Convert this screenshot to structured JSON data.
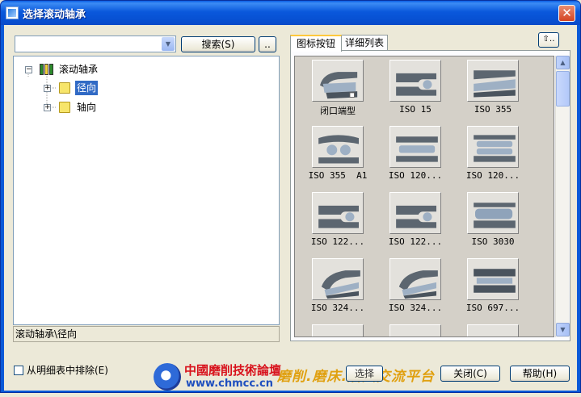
{
  "window": {
    "title": "选择滚动轴承",
    "close_glyph": "✕"
  },
  "search": {
    "value": "",
    "dropdown_glyph": "▼",
    "search_button": "搜索(S)",
    "browse_button": ".."
  },
  "tree": {
    "root": {
      "label": "滚动轴承",
      "expander": "−"
    },
    "children": [
      {
        "label": "径向",
        "expander": "+",
        "selected": true
      },
      {
        "label": "轴向",
        "expander": "+",
        "selected": false
      }
    ]
  },
  "status_path": "滚动轴承\\径向",
  "tabs": [
    {
      "label": "图标按钮",
      "active": true
    },
    {
      "label": "详细列表",
      "active": false
    }
  ],
  "up_button": "⇧‥",
  "grid": {
    "items": [
      {
        "label": "闭口端型",
        "icon": "bearing-sealed-icon"
      },
      {
        "label": "ISO 15",
        "icon": "bearing-groove-icon"
      },
      {
        "label": "ISO 355",
        "icon": "bearing-taper-icon"
      },
      {
        "label": "ISO 355  A1",
        "icon": "bearing-spherical-icon"
      },
      {
        "label": "ISO 120...",
        "icon": "bearing-cylindrical-icon"
      },
      {
        "label": "ISO 120...",
        "icon": "bearing-double-icon"
      },
      {
        "label": "ISO 122...",
        "icon": "bearing-groove-icon"
      },
      {
        "label": "ISO 122...",
        "icon": "bearing-groove-icon"
      },
      {
        "label": "ISO 3030",
        "icon": "bearing-roller-icon"
      },
      {
        "label": "ISO 324...",
        "icon": "bearing-needle-icon"
      },
      {
        "label": "ISO 324...",
        "icon": "bearing-needle-icon"
      },
      {
        "label": "ISO 697...",
        "icon": "bearing-flat-icon"
      }
    ]
  },
  "scroll": {
    "up_glyph": "▲",
    "down_glyph": "▼"
  },
  "exclude_checkbox": {
    "label": "从明细表中排除(E)",
    "checked": false
  },
  "watermark": {
    "title": "中國磨削技術論壇",
    "url": "www.chmcc.cn",
    "slogan": "磨削.磨床.磨具交流平台"
  },
  "buttons": {
    "select": "选择",
    "close": "关闭(C)",
    "help": "帮助(H)"
  },
  "colors": {
    "titlebar": "#0a58dc",
    "selection": "#316ac5",
    "dialog_bg": "#ece9d8",
    "watermark_red": "#d8121c",
    "watermark_gold": "#e0a010"
  }
}
